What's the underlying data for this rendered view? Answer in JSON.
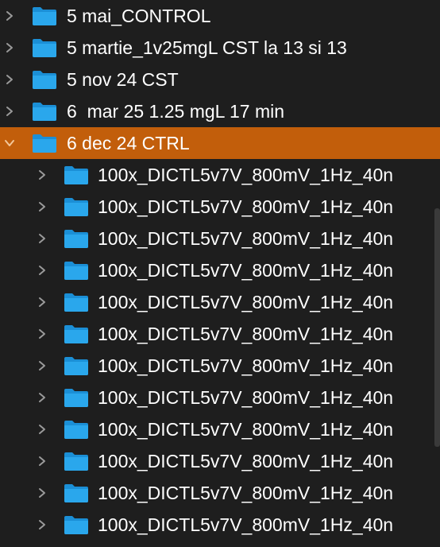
{
  "colors": {
    "background": "#1e1e1e",
    "selected_row": "#c25e0b",
    "folder_blue": "#2aa7ec",
    "chevron": "#9a9a9a"
  },
  "icons": {
    "collapsed": "chevron-right-icon",
    "expanded": "chevron-down-icon",
    "folder": "folder-icon"
  },
  "top_items": [
    {
      "label": "5 mai_CONTROL",
      "expanded": false
    },
    {
      "label": "5 martie_1v25mgL CST la 13 si 13",
      "expanded": false
    },
    {
      "label": "5 nov 24 CST",
      "expanded": false
    },
    {
      "label": "6  mar 25 1.25 mgL 17 min",
      "expanded": false
    },
    {
      "label": "6 dec 24 CTRL",
      "expanded": true,
      "selected": true
    }
  ],
  "children": [
    {
      "label": "100x_DICTL5v7V_800mV_1Hz_40n"
    },
    {
      "label": "100x_DICTL5v7V_800mV_1Hz_40n"
    },
    {
      "label": "100x_DICTL5v7V_800mV_1Hz_40n"
    },
    {
      "label": "100x_DICTL5v7V_800mV_1Hz_40n"
    },
    {
      "label": "100x_DICTL5v7V_800mV_1Hz_40n"
    },
    {
      "label": "100x_DICTL5v7V_800mV_1Hz_40n"
    },
    {
      "label": "100x_DICTL5v7V_800mV_1Hz_40n"
    },
    {
      "label": "100x_DICTL5v7V_800mV_1Hz_40n"
    },
    {
      "label": "100x_DICTL5v7V_800mV_1Hz_40n"
    },
    {
      "label": "100x_DICTL5v7V_800mV_1Hz_40n"
    },
    {
      "label": "100x_DICTL5v7V_800mV_1Hz_40n"
    },
    {
      "label": "100x_DICTL5v7V_800mV_1Hz_40n"
    }
  ]
}
